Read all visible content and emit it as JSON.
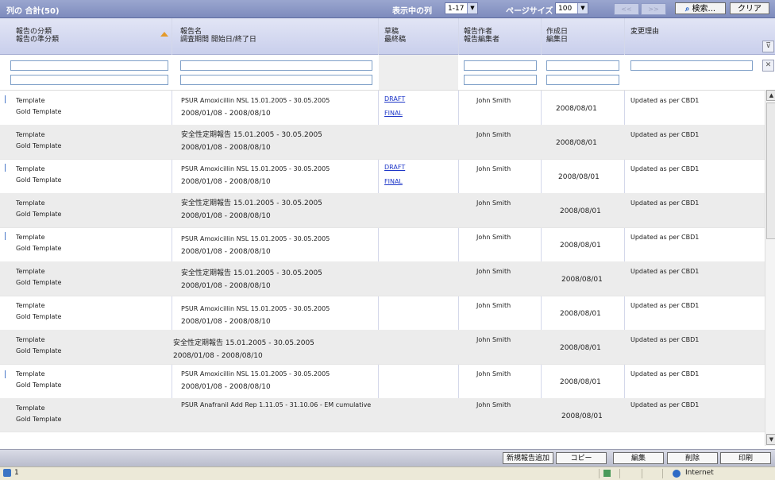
{
  "toolbar": {
    "total_label": "列の 合計(50)",
    "columns_shown_label": "表示中の列",
    "columns_shown_value": "1-17",
    "page_size_label": "ページサイズ",
    "page_size_value": "100",
    "prev_label": "<<",
    "next_label": ">>",
    "search_label": "検索...",
    "clear_label": "クリア"
  },
  "header": {
    "col1_line1": "報告の分類",
    "col1_line2": "報告の準分類",
    "col2_line1": "報告名",
    "col2_line2": "調査期間  開始日/終了日",
    "col3_line1": "草稿",
    "col3_line2": "最終稿",
    "col4_line1": "報告作者",
    "col4_line2": "報告編集者",
    "col5_line1": "作成日",
    "col5_line2": "編集日",
    "col6_line1": "変更理由"
  },
  "rows": [
    {
      "category": "Template",
      "subcategory": "Gold Template",
      "name": "PSUR Amoxicillin NSL 15.01.2005 - 30.05.2005",
      "period": "2008/01/08  -  2008/08/10",
      "draft": "DRAFT",
      "final": "FINAL",
      "author": "John Smith",
      "date": "2008/08/01",
      "reason": "Updated as per CBD1"
    },
    {
      "category": "Template",
      "subcategory": "Gold Template",
      "name": "安全性定期報告       15.01.2005 - 30.05.2005",
      "period": "2008/01/08 - 2008/08/10",
      "draft": "",
      "final": "",
      "author": "John Smith",
      "date": "2008/08/01",
      "reason": "Updated as per CBD1"
    },
    {
      "category": "Template",
      "subcategory": "Gold Template",
      "name": "PSUR Amoxicillin NSL 15.01.2005 - 30.05.2005",
      "period": "2008/01/08  -  2008/08/10",
      "draft": "DRAFT",
      "final": "FINAL",
      "author": "John Smith",
      "date": "2008/08/01",
      "reason": "Updated as per CBD1"
    },
    {
      "category": "Template",
      "subcategory": "Gold Template",
      "name": "安全性定期報告       15.01.2005 - 30.05.2005",
      "period": "2008/01/08 - 2008/08/10",
      "draft": "",
      "final": "",
      "author": "John Smith",
      "date": "2008/08/01",
      "reason": "Updated as per CBD1"
    },
    {
      "category": "Template",
      "subcategory": "Gold Template",
      "name": "PSUR Amoxicillin NSL 15.01.2005 - 30.05.2005",
      "period": "2008/01/08  -  2008/08/10",
      "draft": "",
      "final": "",
      "author": "John Smith",
      "date": "2008/08/01",
      "reason": "Updated as per CBD1"
    },
    {
      "category": "Template",
      "subcategory": "Gold Template",
      "name": "安全性定期報告       15.01.2005 - 30.05.2005",
      "period": "2008/01/08 - 2008/08/10",
      "draft": "",
      "final": "",
      "author": "John Smith",
      "date": "2008/08/01",
      "reason": "Updated as per CBD1"
    },
    {
      "category": "Template",
      "subcategory": "Gold Template",
      "name": "PSUR Amoxicillin NSL 15.01.2005 - 30.05.2005",
      "period": "2008/01/08  -  2008/08/10",
      "draft": "",
      "final": "",
      "author": "John Smith",
      "date": "2008/08/01",
      "reason": "Updated as per CBD1"
    },
    {
      "category": "Template",
      "subcategory": "Gold Template",
      "name": "安全性定期報告       15.01.2005 - 30.05.2005",
      "period": "2008/01/08 - 2008/08/10",
      "draft": "",
      "final": "",
      "author": "John Smith",
      "date": "2008/08/01",
      "reason": "Updated as per CBD1"
    },
    {
      "category": "Template",
      "subcategory": "Gold Template",
      "name": "PSUR Amoxicillin NSL 15.01.2005 - 30.05.2005",
      "period": "2008/01/08  -  2008/08/10",
      "draft": "",
      "final": "",
      "author": "John Smith",
      "date": "2008/08/01",
      "reason": "Updated as per CBD1"
    },
    {
      "category": "Template",
      "subcategory": "Gold Template",
      "name": "PSUR Anafranil Add Rep 1.11.05 - 31.10.06 - EM cumulative",
      "period": "",
      "draft": "",
      "final": "",
      "author": "John Smith",
      "date": "2008/08/01",
      "reason": "Updated as per CBD1"
    }
  ],
  "actions": {
    "new_label": "新規報告追加",
    "copy_label": "コピー",
    "edit_label": "編集",
    "delete_label": "削除",
    "print_label": "印刷"
  },
  "status": {
    "page_count": "1",
    "zone_label": "Internet"
  },
  "colors": {
    "toolbar": "#8591c4",
    "header": "#d6daf1",
    "link": "#1d36c8",
    "sort_arrow": "#e49a2a"
  }
}
